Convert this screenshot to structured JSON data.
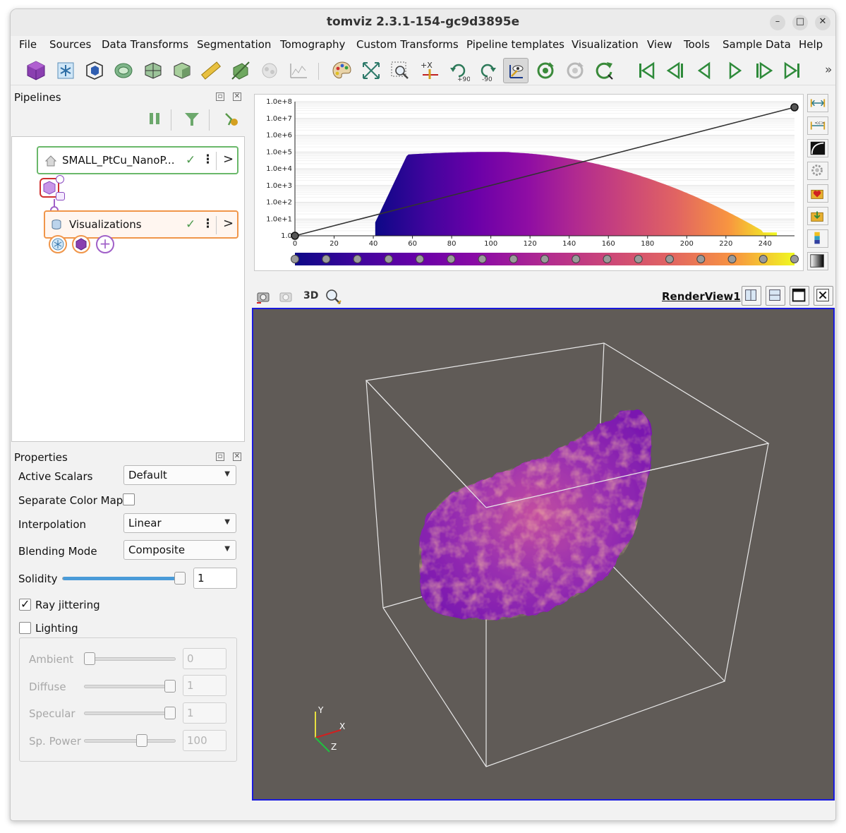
{
  "window": {
    "title": "tomviz 2.3.1-154-gc9d3895e",
    "minimize": "–",
    "maximize": "□",
    "close": "✕"
  },
  "menu": [
    "File",
    "Sources",
    "Data Transforms",
    "Segmentation",
    "Tomography",
    "Custom Transforms",
    "Pipeline templates",
    "Visualization",
    "View",
    "Tools",
    "Sample Data",
    "Help"
  ],
  "toolbar": {
    "icons": [
      "volume-icon",
      "slice-icon",
      "outline-icon",
      "contour-icon",
      "ruler-box-icon",
      "orthogonal-icon",
      "ruler-icon",
      "clip-icon",
      "molecule-icon",
      "plot-icon",
      "color-palette-icon",
      "reset-camera-icon",
      "zoom-to-box-icon",
      "set-view-x-icon",
      "rotate-plus-90-icon",
      "rotate-minus-90-icon",
      "interact-icon",
      "reload-icon",
      "reload-disabled-icon",
      "reset-icon",
      "first-frame-icon",
      "prev-frame-icon",
      "reverse-icon",
      "play-icon",
      "next-frame-icon",
      "last-frame-icon"
    ],
    "rotate_plus": "+90",
    "rotate_minus": "-90",
    "overflow": "»"
  },
  "pipelines": {
    "title": "Pipelines",
    "data_node": {
      "label": "SMALL_PtCu_NanoP...",
      "check": "✓",
      "menu": "⋮",
      "expand": ">"
    },
    "vis_node": {
      "label": "Visualizations",
      "check": "✓",
      "menu": "⋮",
      "expand": ">"
    },
    "add_label": "+"
  },
  "properties": {
    "title": "Properties",
    "active_scalars": {
      "label": "Active Scalars",
      "value": "Default"
    },
    "separate_color_map": {
      "label": "Separate Color Map",
      "checked": false
    },
    "interpolation": {
      "label": "Interpolation",
      "value": "Linear"
    },
    "blending_mode": {
      "label": "Blending Mode",
      "value": "Composite"
    },
    "solidity": {
      "label": "Solidity",
      "value": "1",
      "level": 1.0
    },
    "ray_jittering": {
      "label": "Ray jittering",
      "checked": true,
      "mark": "✓"
    },
    "lighting": {
      "label": "Lighting",
      "checked": false
    },
    "ambient": {
      "label": "Ambient",
      "value": "0",
      "level": 0.0
    },
    "diffuse": {
      "label": "Diffuse",
      "value": "1",
      "level": 1.0
    },
    "specular": {
      "label": "Specular",
      "value": "1",
      "level": 1.0
    },
    "sp_power": {
      "label": "Sp. Power",
      "value": "100",
      "level": 0.65
    }
  },
  "histogram": {
    "y_ticks": [
      "1.0e+8",
      "1.0e+7",
      "1.0e+6",
      "1.0e+5",
      "1.0e+4",
      "1.0e+3",
      "1.0e+2",
      "1.0e+1",
      "1.0"
    ],
    "x_ticks": [
      "0",
      "20",
      "40",
      "60",
      "80",
      "100",
      "120",
      "140",
      "160",
      "180",
      "200",
      "220",
      "240"
    ],
    "x_range": [
      0,
      255
    ],
    "y_log_range": [
      0,
      8
    ],
    "colormap": "plasma",
    "opacity_points": [
      {
        "x": 0,
        "y": 0
      },
      {
        "x": 255,
        "y": 1
      }
    ]
  },
  "render_view": {
    "label": "RenderView1",
    "mode": "3D",
    "background": "#605b57",
    "axes": {
      "x": "X",
      "y": "Y",
      "z": "Z"
    }
  },
  "colors": {
    "pipeline_green": "#5cb85c",
    "vis_orange": "#f0964a",
    "accent_blue": "#1a1adc"
  }
}
